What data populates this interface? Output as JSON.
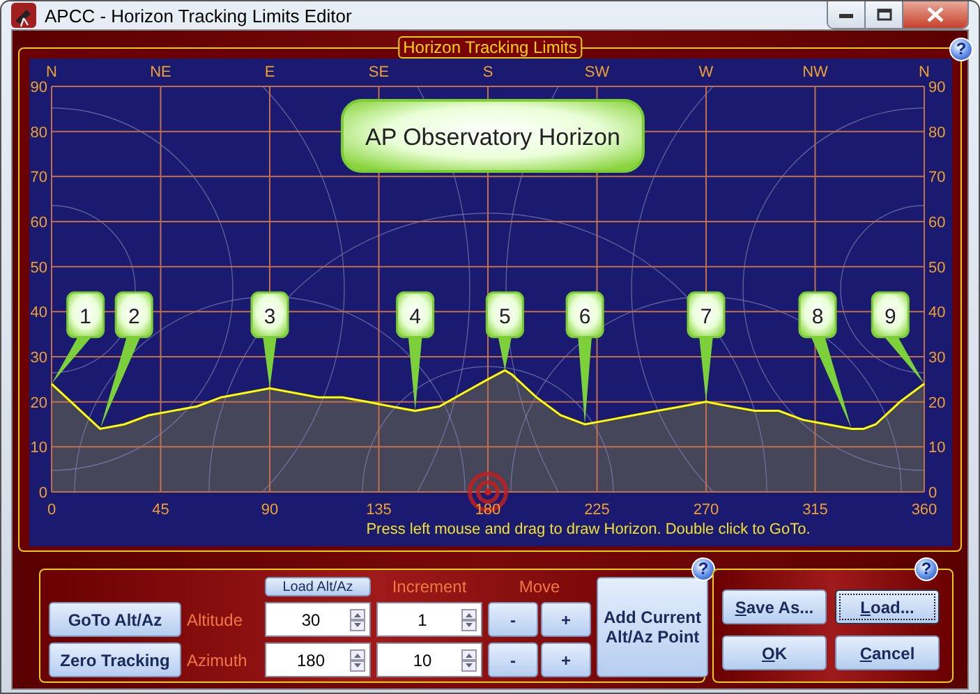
{
  "window": {
    "title": "APCC - Horizon Tracking Limits Editor"
  },
  "horizon_panel": {
    "title": "Horizon Tracking Limits",
    "help": "?",
    "compass": [
      "N",
      "NE",
      "E",
      "SE",
      "S",
      "SW",
      "W",
      "NW",
      "N"
    ],
    "right_axis_labels": [
      "90",
      "80",
      "70",
      "60",
      "50",
      "40",
      "30",
      "20",
      "10",
      "0"
    ],
    "chart_data": {
      "type": "area",
      "title": "AP Observatory Horizon",
      "grid": true,
      "xlim": [
        0,
        360
      ],
      "ylim": [
        0,
        90
      ],
      "xticks": [
        0,
        45,
        90,
        135,
        180,
        225,
        270,
        315,
        360
      ],
      "yticks": [
        0,
        10,
        20,
        30,
        40,
        50,
        60,
        70,
        80,
        90
      ],
      "x": [
        0,
        10,
        20,
        30,
        40,
        50,
        60,
        70,
        80,
        90,
        100,
        110,
        120,
        130,
        140,
        150,
        160,
        170,
        180,
        187,
        190,
        200,
        210,
        220,
        230,
        240,
        250,
        260,
        270,
        280,
        290,
        300,
        310,
        320,
        330,
        335,
        340,
        350,
        360
      ],
      "series": [
        {
          "color": "#ffff00",
          "values": [
            24,
            19,
            14,
            15,
            17,
            18,
            19,
            21,
            22,
            23,
            22,
            21,
            21,
            20,
            19,
            18,
            19,
            22,
            25,
            27,
            26,
            21,
            17,
            15,
            16,
            17,
            18,
            19,
            20,
            19,
            18,
            18,
            16,
            15,
            14,
            14,
            15,
            20,
            24
          ]
        }
      ],
      "annotations": [
        {
          "text": "1",
          "x": 0,
          "y": 24
        },
        {
          "text": "2",
          "x": 20,
          "y": 14
        },
        {
          "text": "3",
          "x": 90,
          "y": 23
        },
        {
          "text": "4",
          "x": 150,
          "y": 18
        },
        {
          "text": "5",
          "x": 187,
          "y": 27
        },
        {
          "text": "6",
          "x": 220,
          "y": 15
        },
        {
          "text": "7",
          "x": 270,
          "y": 20
        },
        {
          "text": "8",
          "x": 330,
          "y": 14
        },
        {
          "text": "9",
          "x": 360,
          "y": 24
        }
      ]
    },
    "hint": "Press left mouse and drag to draw Horizon. Double click to GoTo."
  },
  "controls": {
    "help": "?",
    "goto_button": "GoTo Alt/Az",
    "zero_button": "Zero Tracking",
    "load_altaz_button": "Load Alt/Az",
    "increment_header": "Increment",
    "move_header": "Move",
    "rows": [
      {
        "label": "Altitude",
        "value": "30",
        "increment": "1",
        "minus": "-",
        "plus": "+"
      },
      {
        "label": "Azimuth",
        "value": "180",
        "increment": "10",
        "minus": "-",
        "plus": "+"
      }
    ],
    "add_point_button": "Add Current Alt/Az Point"
  },
  "file_panel": {
    "help": "?",
    "buttons": [
      {
        "label": "Save As...",
        "mnemonic": true,
        "focused": false
      },
      {
        "label": "Load...",
        "mnemonic": true,
        "focused": true
      },
      {
        "label": "OK",
        "mnemonic": true,
        "focused": false
      },
      {
        "label": "Cancel",
        "mnemonic": true,
        "focused": false
      }
    ]
  }
}
